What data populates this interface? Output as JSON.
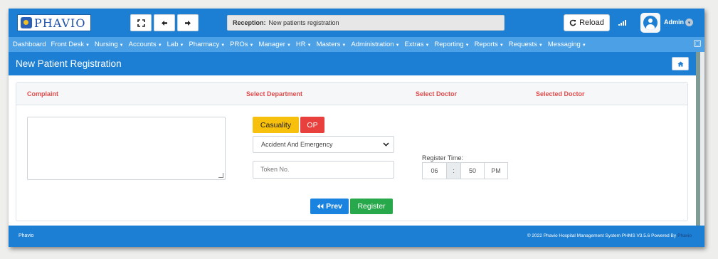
{
  "app": {
    "logo_text": "PHAVIO",
    "window_title_prefix": "Reception:",
    "window_title": "New patients registration",
    "reload_label": "Reload",
    "user_name": "Admin"
  },
  "toolbar": {
    "fullscreen_icon": "expand-icon",
    "back_icon": "arrow-left-icon",
    "forward_icon": "arrow-right-icon"
  },
  "menu": {
    "items": [
      {
        "label": "Dashboard",
        "dropdown": false
      },
      {
        "label": "Front Desk",
        "dropdown": true
      },
      {
        "label": "Nursing",
        "dropdown": true
      },
      {
        "label": "Accounts",
        "dropdown": true
      },
      {
        "label": "Lab",
        "dropdown": true
      },
      {
        "label": "Pharmacy",
        "dropdown": true
      },
      {
        "label": "PROs",
        "dropdown": true
      },
      {
        "label": "Manager",
        "dropdown": true
      },
      {
        "label": "HR",
        "dropdown": true
      },
      {
        "label": "Masters",
        "dropdown": true
      },
      {
        "label": "Administration",
        "dropdown": true
      },
      {
        "label": "Extras",
        "dropdown": true
      },
      {
        "label": "Reporting",
        "dropdown": true
      },
      {
        "label": "Reports",
        "dropdown": true
      },
      {
        "label": "Requests",
        "dropdown": true
      },
      {
        "label": "Messaging",
        "dropdown": true
      }
    ]
  },
  "page": {
    "title": "New Patient Registration"
  },
  "form": {
    "headers": {
      "complaint": "Complaint",
      "department": "Select Department",
      "doctor": "Select Doctor",
      "selected_doctor": "Selected Doctor"
    },
    "complaint_value": "",
    "casualty_label": "Casuality",
    "op_label": "OP",
    "department_selected": "Accident And Emergency",
    "token_placeholder": "Token No.",
    "register_time_label": "Register Time:",
    "time_hour": "06",
    "time_sep": ":",
    "time_minute": "50",
    "time_ampm": "PM",
    "prev_label": "Prev",
    "register_label": "Register"
  },
  "footer": {
    "left": "Phavio",
    "right": "© 2022 Phavio Hospital Management System PHMS V3.5.6 Powered By",
    "brand": "Phavio"
  },
  "colors": {
    "primary": "#1c7fd4",
    "menu": "#4ba0e6",
    "header_text": "#e14a4a",
    "casualty": "#f7c00c",
    "op": "#e8403c",
    "prev": "#1a83df",
    "register": "#27a84a"
  }
}
